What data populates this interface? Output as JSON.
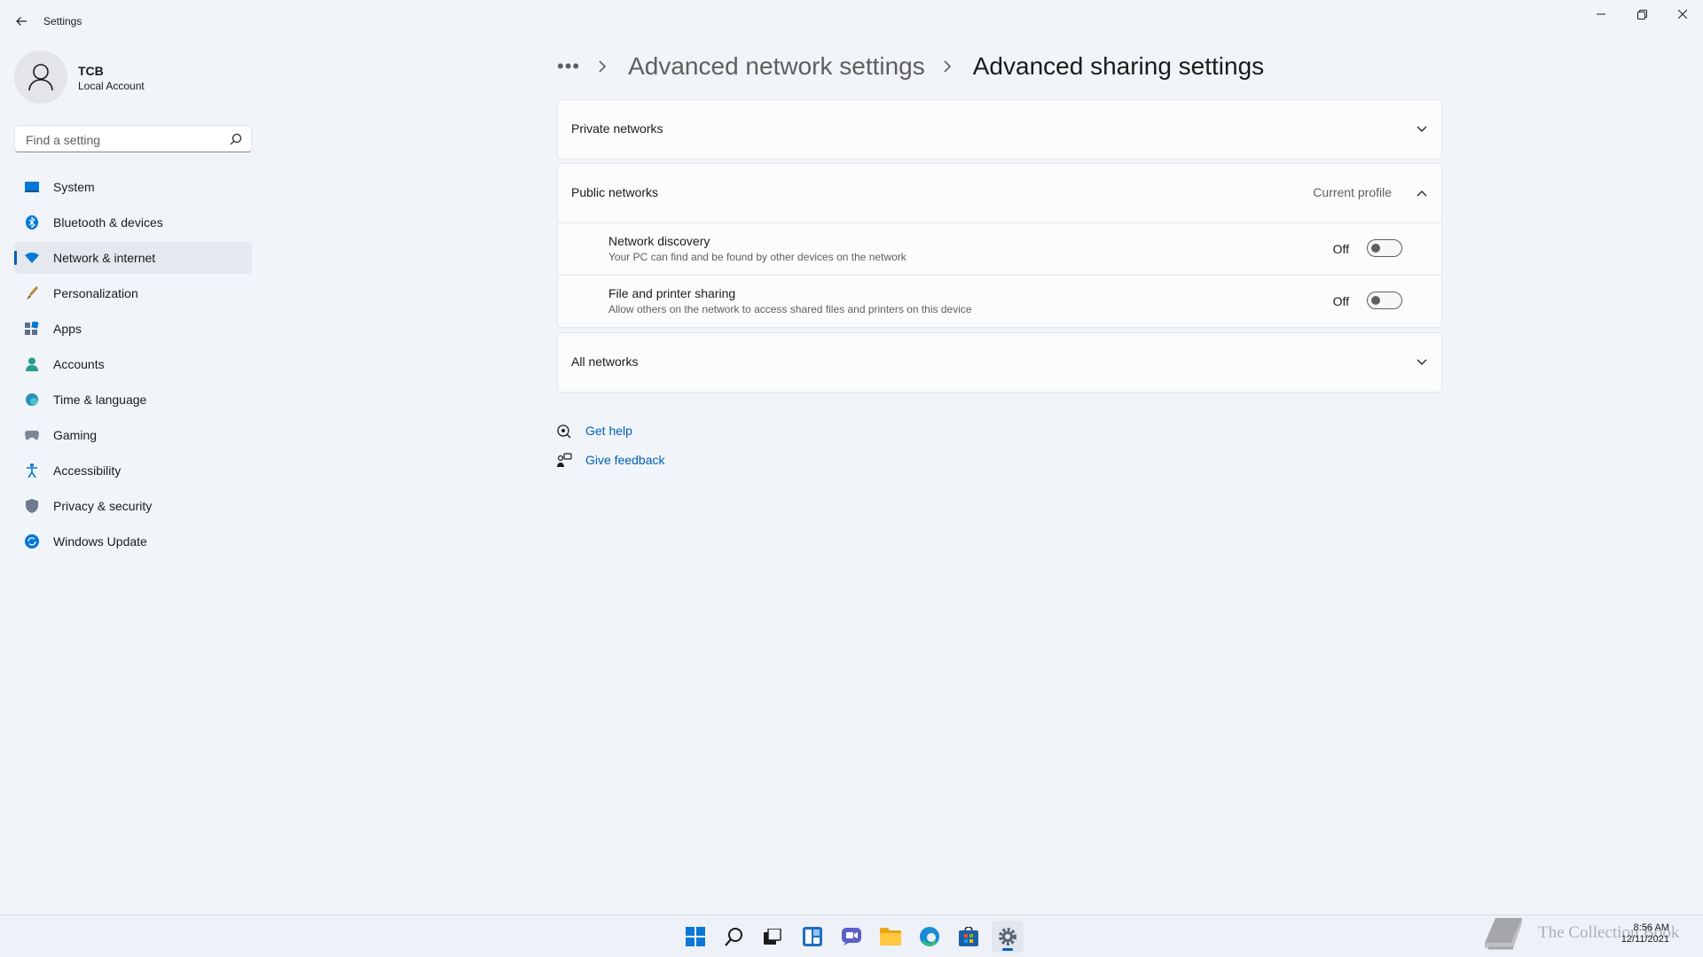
{
  "window": {
    "app_title": "Settings",
    "icons": {
      "back": "back-arrow-icon",
      "minimize": "minimize-icon",
      "restore": "restore-icon",
      "close": "close-icon"
    }
  },
  "profile": {
    "name": "TCB",
    "account_type": "Local Account"
  },
  "search": {
    "placeholder": "Find a setting",
    "value": ""
  },
  "sidebar": {
    "selected_index": 2,
    "accent_color": "#005fb8",
    "items": [
      {
        "label": "System",
        "icon": "system-icon"
      },
      {
        "label": "Bluetooth & devices",
        "icon": "bluetooth-icon"
      },
      {
        "label": "Network & internet",
        "icon": "wifi-icon"
      },
      {
        "label": "Personalization",
        "icon": "brush-icon"
      },
      {
        "label": "Apps",
        "icon": "apps-icon"
      },
      {
        "label": "Accounts",
        "icon": "accounts-icon"
      },
      {
        "label": "Time & language",
        "icon": "time-language-icon"
      },
      {
        "label": "Gaming",
        "icon": "gaming-icon"
      },
      {
        "label": "Accessibility",
        "icon": "accessibility-icon"
      },
      {
        "label": "Privacy & security",
        "icon": "shield-icon"
      },
      {
        "label": "Windows Update",
        "icon": "windows-update-icon"
      }
    ]
  },
  "breadcrumb": {
    "more": "•••",
    "parent": "Advanced network settings",
    "current": "Advanced sharing settings"
  },
  "sections": {
    "private": {
      "title": "Private networks",
      "expanded": false
    },
    "public": {
      "title": "Public networks",
      "badge": "Current profile",
      "expanded": true,
      "settings": [
        {
          "title": "Network discovery",
          "description": "Your PC can find and be found by other devices on the network",
          "state": "Off",
          "on": false
        },
        {
          "title": "File and printer sharing",
          "description": "Allow others on the network to access shared files and printers on this device",
          "state": "Off",
          "on": false
        }
      ]
    },
    "all": {
      "title": "All networks",
      "expanded": false
    }
  },
  "help": {
    "get_help": "Get help",
    "give_feedback": "Give feedback"
  },
  "taskbar": {
    "apps": [
      "start-icon",
      "search-icon",
      "task-view-icon",
      "widgets-icon",
      "chat-icon",
      "file-explorer-icon",
      "edge-icon",
      "store-icon",
      "settings-icon"
    ],
    "active_app": "settings-icon"
  },
  "watermark": {
    "text": "The Collection Book"
  },
  "clock": {
    "time": "8:56 AM",
    "date": "12/11/2021"
  }
}
